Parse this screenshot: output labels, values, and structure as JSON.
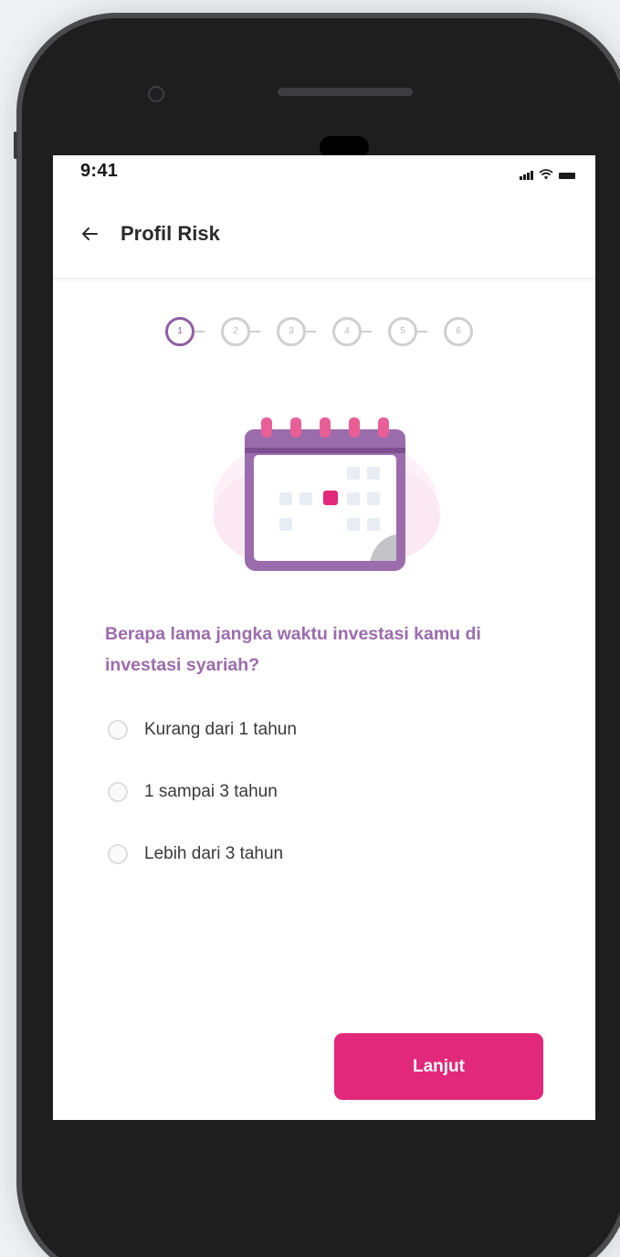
{
  "status_bar": {
    "time": "9:41",
    "icons": [
      "cellular-signal-icon",
      "wifi-icon",
      "battery-icon"
    ]
  },
  "header": {
    "back_icon": "arrow-left-icon",
    "title": "Profil Risk"
  },
  "stepper": {
    "steps": [
      "1",
      "2",
      "3",
      "4",
      "5",
      "6"
    ],
    "current_step": 1
  },
  "illustration": {
    "icon": "calendar-icon"
  },
  "question": {
    "text": "Berapa lama jangka waktu investasi kamu di investasi syariah?"
  },
  "options": [
    {
      "label": "Kurang dari 1 tahun",
      "selected": false
    },
    {
      "label": "1 sampai 3 tahun",
      "selected": false
    },
    {
      "label": "Lebih dari 3 tahun",
      "selected": false
    }
  ],
  "actions": {
    "next_label": "Lanjut"
  },
  "colors": {
    "accent_purple": "#8e5ea2",
    "question_text": "#9b6cac",
    "primary_button": "#e1287a",
    "calendar_header": "#9b6cac",
    "calendar_tabs": "#e85f98"
  }
}
